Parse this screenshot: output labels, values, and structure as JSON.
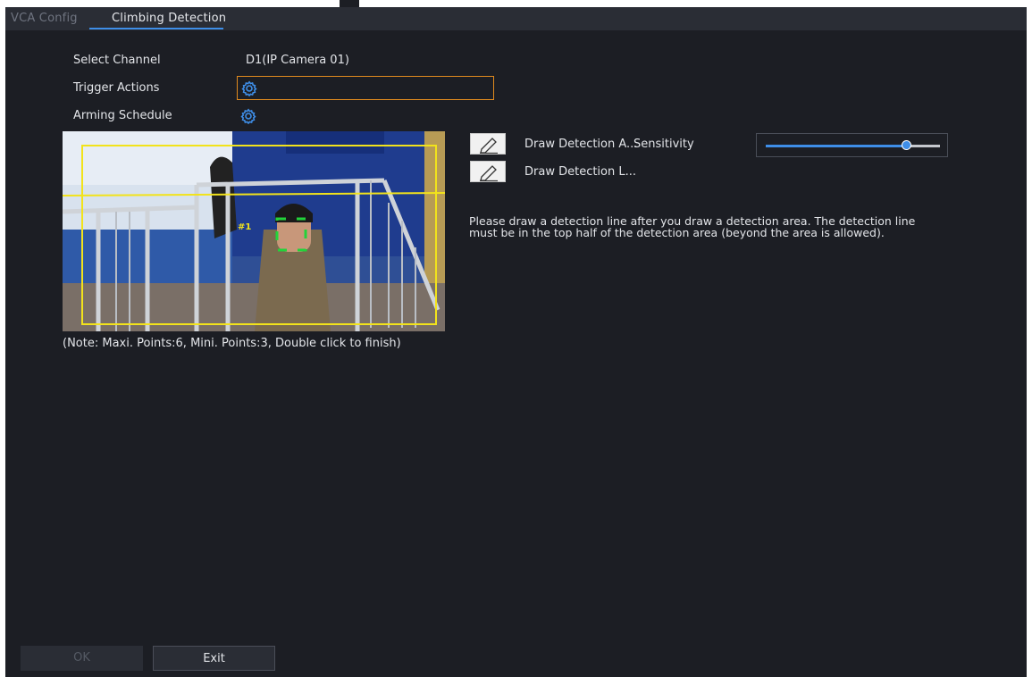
{
  "tabs": [
    {
      "label": "VCA Config",
      "active": false
    },
    {
      "label": "Climbing Detection",
      "active": true
    }
  ],
  "form": {
    "select_channel_label": "Select Channel",
    "select_channel_value": "D1(IP Camera 01)",
    "trigger_actions_label": "Trigger Actions",
    "arming_schedule_label": "Arming Schedule"
  },
  "video": {
    "overlay_tag": "#1"
  },
  "note": "(Note: Maxi. Points:6, Mini. Points:3, Double click to finish)",
  "tools": {
    "draw_area_label": "Draw Detection A...",
    "draw_line_label": "Draw Detection L...",
    "sensitivity_label": "Sensitivity",
    "sensitivity_level": 0.81
  },
  "hint": "Please draw a detection line after you draw a detection area. The detection line must be in the top half of the detection area (beyond the area is allowed).",
  "buttons": {
    "ok": "OK",
    "exit": "Exit"
  },
  "colors": {
    "accent": "#3e8ee8",
    "focus_border": "#e08a1e",
    "overlay": "#f2e31b",
    "face_box": "#22d33a",
    "background": "#1c1e24"
  }
}
